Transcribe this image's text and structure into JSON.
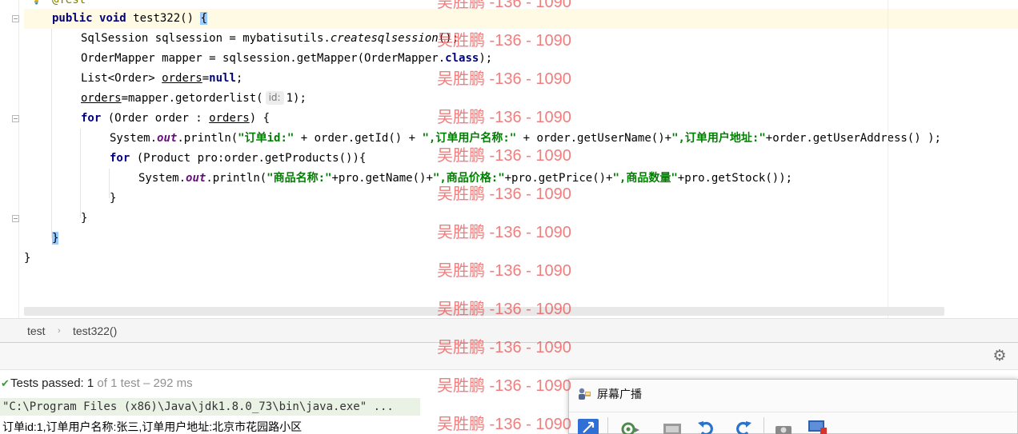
{
  "editor": {
    "annotation": "@Test",
    "lines": [
      {
        "tokens": [
          {
            "t": "public",
            "c": "kw"
          },
          {
            "t": " "
          },
          {
            "t": "void",
            "c": "kw"
          },
          {
            "t": " test322() "
          },
          {
            "t": "{",
            "c": "brace-hl"
          }
        ]
      },
      {
        "tokens": [
          {
            "t": "SqlSession sqlsession = mybatisutils."
          },
          {
            "t": "createsqlsession",
            "c": "ital"
          },
          {
            "t": "();"
          }
        ]
      },
      {
        "tokens": [
          {
            "t": "OrderMapper mapper = sqlsession.getMapper(OrderMapper."
          },
          {
            "t": "class",
            "c": "kw"
          },
          {
            "t": ");"
          }
        ]
      },
      {
        "tokens": [
          {
            "t": "List<Order> "
          },
          {
            "t": "orders",
            "c": "uline"
          },
          {
            "t": "="
          },
          {
            "t": "null",
            "c": "kw"
          },
          {
            "t": ";"
          }
        ]
      },
      {
        "tokens": [
          {
            "t": "orders",
            "c": "uline"
          },
          {
            "t": "=mapper.getorderlist("
          },
          {
            "t": "id:",
            "c": "hint"
          },
          {
            "t": "1);"
          }
        ]
      },
      {
        "tokens": [
          {
            "t": "for",
            "c": "kw"
          },
          {
            "t": " (Order order : "
          },
          {
            "t": "orders",
            "c": "uline"
          },
          {
            "t": ") {"
          }
        ]
      },
      {
        "tokens": [
          {
            "t": "System."
          },
          {
            "t": "out",
            "c": "field"
          },
          {
            "t": ".println("
          },
          {
            "t": "\"订单id:\"",
            "c": "str"
          },
          {
            "t": " + order.getId() + "
          },
          {
            "t": "\",订单用户名称:\"",
            "c": "str"
          },
          {
            "t": " + order.getUserName()+"
          },
          {
            "t": "\",订单用户地址:\"",
            "c": "str"
          },
          {
            "t": "+order.getUserAddress() );"
          }
        ]
      },
      {
        "tokens": [
          {
            "t": "for",
            "c": "kw"
          },
          {
            "t": " (Product pro:order.getProducts()){"
          }
        ]
      },
      {
        "tokens": [
          {
            "t": "System."
          },
          {
            "t": "out",
            "c": "field"
          },
          {
            "t": ".println("
          },
          {
            "t": "\"商品名称:\"",
            "c": "str"
          },
          {
            "t": "+pro.getName()+"
          },
          {
            "t": "\",商品价格:\"",
            "c": "str"
          },
          {
            "t": "+pro.getPrice()+"
          },
          {
            "t": "\",商品数量\"",
            "c": "str"
          },
          {
            "t": "+pro.getStock());"
          }
        ]
      },
      {
        "tokens": [
          {
            "t": "}"
          }
        ]
      },
      {
        "tokens": [
          {
            "t": "}"
          }
        ]
      },
      {
        "tokens": [
          {
            "t": "}",
            "c": "brace-hl"
          }
        ]
      },
      {
        "tokens": [
          {
            "t": "}"
          }
        ]
      }
    ]
  },
  "breadcrumb": {
    "class_name": "test",
    "method_name": "test322()"
  },
  "run": {
    "status_label": "Tests passed:",
    "status_count": "1",
    "status_detail": "of 1 test – 292 ms",
    "command": "\"C:\\Program Files (x86)\\Java\\jdk1.8.0_73\\bin\\java.exe\" ...",
    "output": "订单id:1,订单用户名称:张三,订单用户地址:北京市花园路小区"
  },
  "broadcast_window": {
    "title": "屏幕广播"
  },
  "watermark": {
    "text": "吴胜鹏 -136 - 1090"
  },
  "colors": {
    "keyword": "#000080",
    "string": "#008000",
    "field": "#660e7a",
    "current_line": "#fffae3",
    "watermark": "#eb4646"
  }
}
